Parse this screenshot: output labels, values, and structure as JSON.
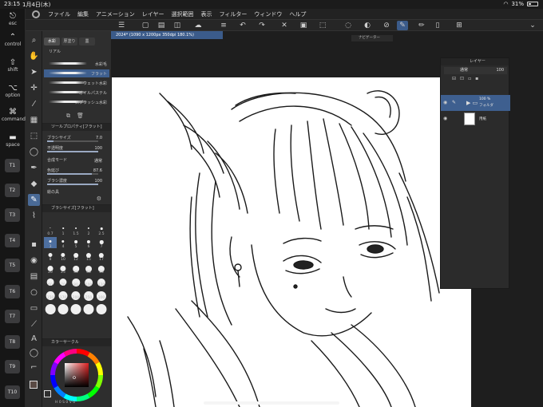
{
  "status": {
    "time": "23:15",
    "date": "1月4日(木)",
    "battery": "31%"
  },
  "shortcuts": [
    {
      "glyph": "⎋",
      "label": "esc"
    },
    {
      "glyph": "⌃",
      "label": "control"
    },
    {
      "glyph": "⇧",
      "label": "shift"
    },
    {
      "glyph": "⌥",
      "label": "option"
    },
    {
      "glyph": "⌘",
      "label": "command"
    },
    {
      "glyph": "▬",
      "label": "space"
    }
  ],
  "tkeys": [
    "T1",
    "T2",
    "T3",
    "T4",
    "T5",
    "T6",
    "T7",
    "T8",
    "T9",
    "T10"
  ],
  "menu": [
    "ファイル",
    "編集",
    "アニメーション",
    "レイヤー",
    "選択範囲",
    "表示",
    "フィルター",
    "ウィンドウ",
    "ヘルプ"
  ],
  "subtool": {
    "tabs": [
      "水彩",
      "厚塗り",
      "墨"
    ],
    "group": "リアル",
    "items": [
      {
        "label": "水彩毛",
        "active": false
      },
      {
        "label": "フラット",
        "active": true
      },
      {
        "label": "ウェット水彩",
        "active": false
      },
      {
        "label": "オイルパステル",
        "active": false
      },
      {
        "label": "スプラッシュ水彩",
        "active": false
      }
    ]
  },
  "toolprop": {
    "title": "ツールプロパティ[フラット]",
    "rows": [
      {
        "label": "ブラシサイズ",
        "value": "7.0",
        "fill": 0.12
      },
      {
        "label": "不透明度",
        "value": "100",
        "fill": 1.0
      },
      {
        "label": "合成モード",
        "value": "通常",
        "fill": null
      },
      {
        "label": "色延び",
        "value": "87.6",
        "fill": 0.87
      },
      {
        "label": "ブラシ濃度",
        "value": "100",
        "fill": 1.0
      },
      {
        "label": "絵の具",
        "value": "",
        "fill": null
      }
    ]
  },
  "brushsize": {
    "title": "ブラシサイズ[フラット]",
    "sizes": [
      "0.7",
      "1",
      "1.5",
      "2",
      "2.5",
      "3",
      "4",
      "5",
      "6",
      "7",
      "8",
      "10",
      "12",
      "15",
      "17",
      "20",
      "25",
      "30",
      "40",
      "50",
      "60",
      "70",
      "80",
      "100",
      "120",
      "150",
      "170",
      "200",
      "250",
      "300",
      "",
      "",
      "",
      "",
      ""
    ]
  },
  "color": {
    "title": "カラーサークル",
    "readout": "H 0  S 0  V 0",
    "fg": "#5a4a44",
    "bg": "#ffffff"
  },
  "document": {
    "tab": "2024* (1090 x 1200px 350dpi 180.1%)"
  },
  "navigator": {
    "title": "ナビゲーター"
  },
  "layers": {
    "title": "レイヤー",
    "blend": "通常",
    "opacity": "100",
    "items": [
      {
        "name": "フォルダ",
        "pct": "100 %",
        "active": true
      },
      {
        "name": "用紙",
        "pct": "",
        "active": false
      }
    ]
  }
}
